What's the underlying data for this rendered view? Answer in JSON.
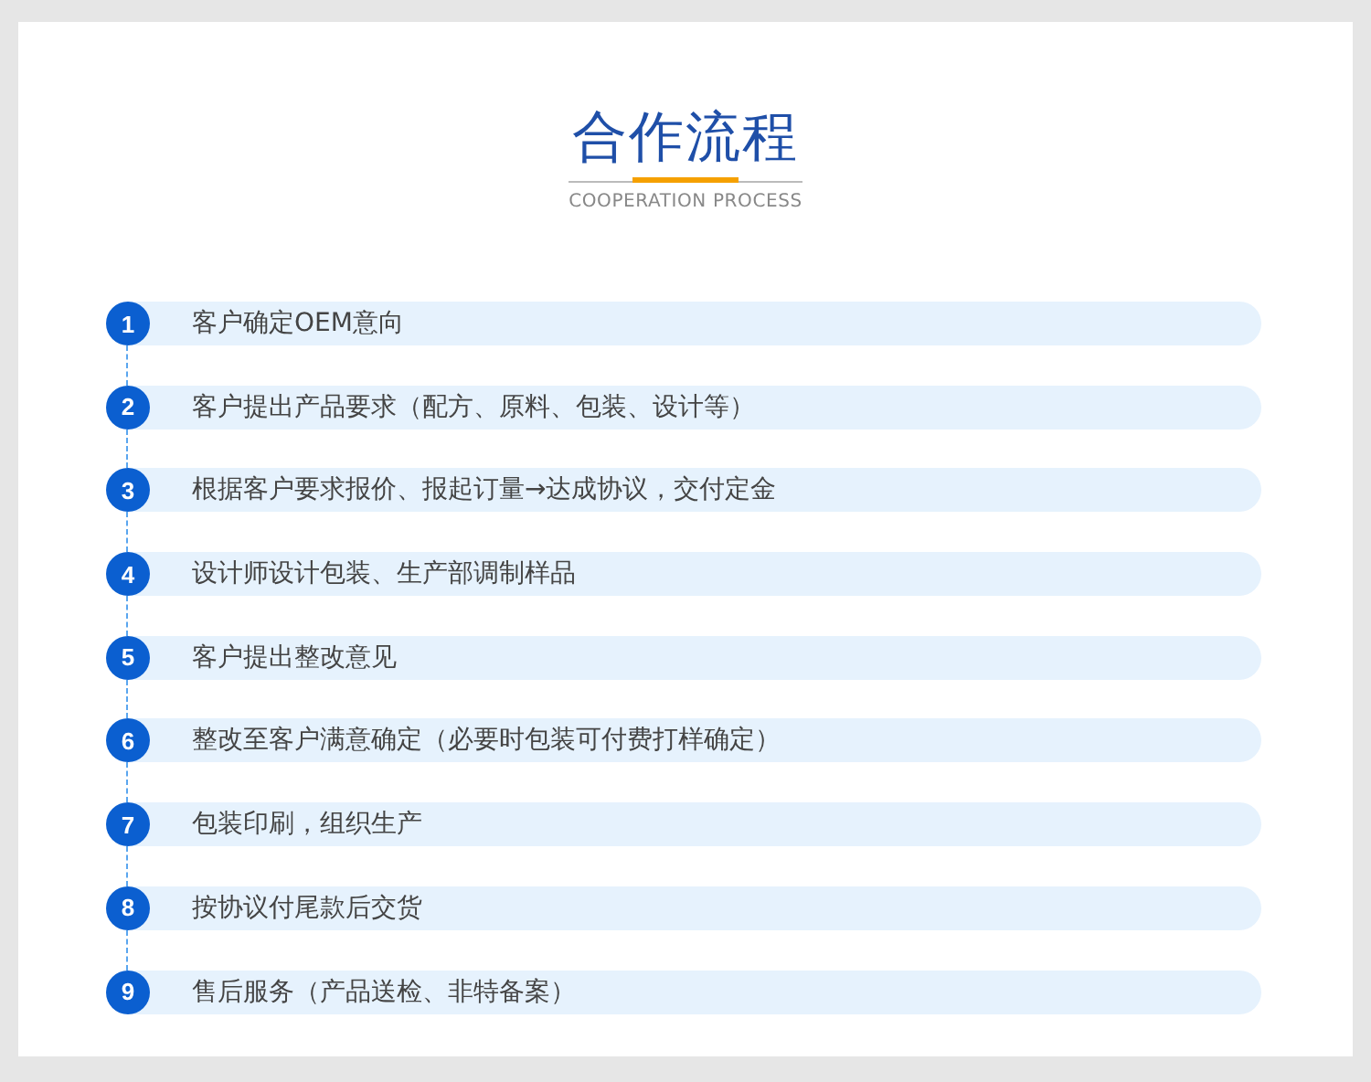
{
  "header": {
    "title": "合作流程",
    "subtitle": "COOPERATION PROCESS"
  },
  "steps": [
    {
      "number": "1",
      "text": "客户确定OEM意向"
    },
    {
      "number": "2",
      "text": "客户提出产品要求（配方、原料、包装、设计等）"
    },
    {
      "number": "3",
      "text": "根据客户要求报价、报起订量→达成协议，交付定金"
    },
    {
      "number": "4",
      "text": "设计师设计包装、生产部调制样品"
    },
    {
      "number": "5",
      "text": "客户提出整改意见"
    },
    {
      "number": "6",
      "text": "整改至客户满意确定（必要时包装可付费打样确定）"
    },
    {
      "number": "7",
      "text": "包装印刷，组织生产"
    },
    {
      "number": "8",
      "text": "按协议付尾款后交货"
    },
    {
      "number": "9",
      "text": "售后服务（产品送检、非特备案）"
    }
  ]
}
